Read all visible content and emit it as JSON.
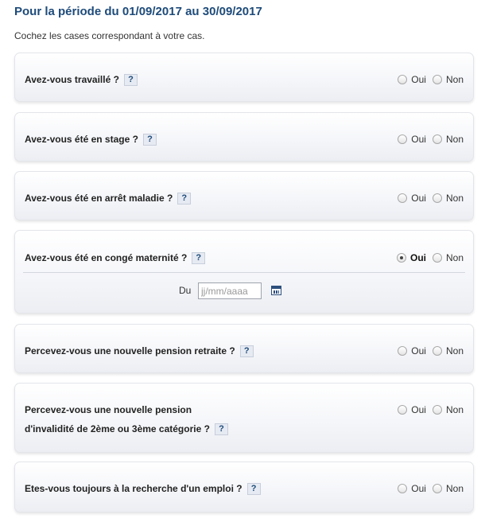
{
  "header": {
    "title": "Pour la période du 01/09/2017 au 30/09/2017",
    "subtitle": "Cochez les cases correspondant à votre cas."
  },
  "options": {
    "yes": "Oui",
    "no": "Non"
  },
  "help_label": "?",
  "questions": [
    {
      "label": "Avez-vous travaillé ?",
      "selected": "none"
    },
    {
      "label": "Avez-vous été en stage ?",
      "selected": "none"
    },
    {
      "label": "Avez-vous été en arrêt maladie ?",
      "selected": "none"
    },
    {
      "label": "Avez-vous été en congé maternité ?",
      "selected": "Oui",
      "date": {
        "label": "Du",
        "placeholder": "jj/mm/aaaa",
        "value": ""
      }
    },
    {
      "label": "Percevez-vous une nouvelle pension retraite ?",
      "selected": "none"
    },
    {
      "label_line1": "Percevez-vous une nouvelle pension",
      "label_line2": "d'invalidité de 2ème ou 3ème catégorie ?",
      "selected": "none"
    },
    {
      "label": "Etes-vous toujours à la recherche d'un emploi ?",
      "selected": "none"
    }
  ]
}
